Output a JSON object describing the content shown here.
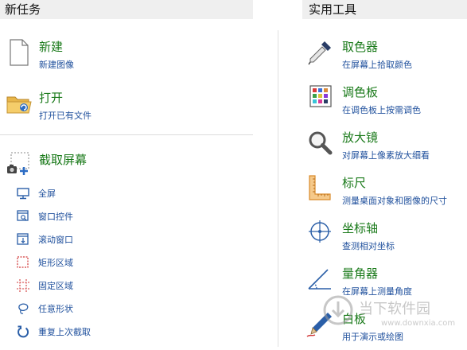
{
  "headers": {
    "new_task": "新任务",
    "utilities": "实用工具"
  },
  "new_tasks": [
    {
      "title": "新建",
      "subtitle": "新建图像"
    },
    {
      "title": "打开",
      "subtitle": "打开已有文件"
    },
    {
      "title": "截取屏幕",
      "subtitle": ""
    }
  ],
  "capture_options": [
    {
      "label": "全屏",
      "icon": "monitor-icon"
    },
    {
      "label": "窗口控件",
      "icon": "window-search-icon"
    },
    {
      "label": "滚动窗口",
      "icon": "scroll-window-icon"
    },
    {
      "label": "矩形区域",
      "icon": "rectangle-select-icon"
    },
    {
      "label": "固定区域",
      "icon": "fixed-region-icon"
    },
    {
      "label": "任意形状",
      "icon": "lasso-icon"
    },
    {
      "label": "重复上次截取",
      "icon": "repeat-icon"
    }
  ],
  "tools": [
    {
      "title": "取色器",
      "subtitle": "在屏幕上拾取颜色",
      "icon": "eyedropper-icon"
    },
    {
      "title": "调色板",
      "subtitle": "在调色板上按需调色",
      "icon": "palette-icon"
    },
    {
      "title": "放大镜",
      "subtitle": "对屏幕上像素放大细看",
      "icon": "magnifier-icon"
    },
    {
      "title": "标尺",
      "subtitle": "测量桌面对象和图像的尺寸",
      "icon": "ruler-icon"
    },
    {
      "title": "坐标轴",
      "subtitle": "查测相对坐标",
      "icon": "crosshair-icon"
    },
    {
      "title": "量角器",
      "subtitle": "在屏幕上测量角度",
      "icon": "protractor-icon"
    },
    {
      "title": "白板",
      "subtitle": "用于演示或绘图",
      "icon": "whiteboard-pen-icon"
    }
  ],
  "watermark": {
    "text": "当下软件园",
    "url": "www.downxia.com"
  },
  "colors": {
    "title_green": "#1a7a1a",
    "link_blue": "#1e4f9c",
    "header_bg": "#efefef"
  }
}
